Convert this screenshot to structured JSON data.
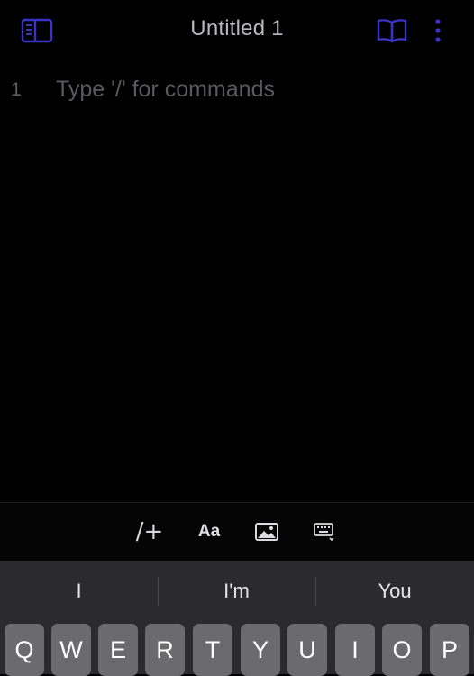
{
  "header": {
    "title": "Untitled 1",
    "left_icon": "sidebar-toggle-icon",
    "right_icons": [
      "book-reader-icon",
      "more-vertical-icon"
    ],
    "accent_color": "#3a34c4"
  },
  "editor": {
    "line_number": "1",
    "placeholder": "Type '/' for commands"
  },
  "format_toolbar": {
    "slash_label": "/+",
    "text_style_label": "Aa",
    "image_icon": "image-icon",
    "keyboard_icon": "keyboard-dismiss-icon"
  },
  "keyboard": {
    "suggestions": [
      "I",
      "I'm",
      "You"
    ],
    "row1": [
      "Q",
      "W",
      "E",
      "R",
      "T",
      "Y",
      "U",
      "I",
      "O",
      "P"
    ]
  }
}
